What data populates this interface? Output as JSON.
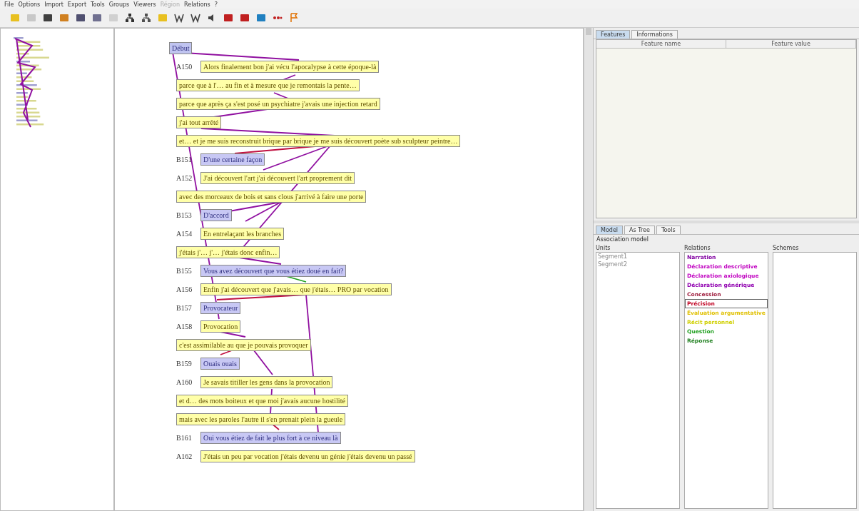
{
  "menu": [
    {
      "label": "File",
      "disabled": false
    },
    {
      "label": "Options",
      "disabled": false
    },
    {
      "label": "Import",
      "disabled": false
    },
    {
      "label": "Export",
      "disabled": false
    },
    {
      "label": "Tools",
      "disabled": false
    },
    {
      "label": "Groups",
      "disabled": false
    },
    {
      "label": "Viewers",
      "disabled": false
    },
    {
      "label": "Région",
      "disabled": true
    },
    {
      "label": "Relations",
      "disabled": false
    },
    {
      "label": "?",
      "disabled": false
    }
  ],
  "segments": [
    {
      "kind": "start",
      "text": "Début"
    },
    {
      "kind": "a",
      "speaker": "A150",
      "text": "Alors finalement bon j'ai vécu l'apocalypse à cette époque-là"
    },
    {
      "kind": "a",
      "text": "parce que à l'… au fin et à mesure que je remontais la pente…"
    },
    {
      "kind": "a",
      "text": "parce que après ça s'est posé un psychiatre j'avais une injection retard"
    },
    {
      "kind": "a",
      "text": "j'ai tout arrêté"
    },
    {
      "kind": "a",
      "text": "et… et je me suis reconstruit brique par brique je me suis découvert poète sub sculpteur peintre…"
    },
    {
      "kind": "b",
      "speaker": "B151",
      "text": "D'une certaine façon"
    },
    {
      "kind": "a",
      "speaker": "A152",
      "text": "J'ai découvert l'art j'ai découvert l'art proprement dit"
    },
    {
      "kind": "a",
      "text": "avec des morceaux de bois et sans clous j'arrivé à faire une porte"
    },
    {
      "kind": "b",
      "speaker": "B153",
      "text": "D'accord"
    },
    {
      "kind": "a",
      "speaker": "A154",
      "text": "En entrelaçant les branches"
    },
    {
      "kind": "a",
      "text": "j'étais j'… j'… j'étais donc enfin…"
    },
    {
      "kind": "b",
      "speaker": "B155",
      "text": "Vous avez découvert que vous étiez doué en fait?"
    },
    {
      "kind": "a",
      "speaker": "A156",
      "text": "Enfin j'ai découvert que j'avais… que j'étais… PRO par vocation"
    },
    {
      "kind": "b",
      "speaker": "B157",
      "text": "Provocateur"
    },
    {
      "kind": "a",
      "speaker": "A158",
      "text": "Provocation"
    },
    {
      "kind": "a",
      "text": "c'est assimilable au que je pouvais provoquer"
    },
    {
      "kind": "b",
      "speaker": "B159",
      "text": "Ouais ouais"
    },
    {
      "kind": "a",
      "speaker": "A160",
      "text": "Je savais titiller les gens dans la provocation"
    },
    {
      "kind": "a",
      "text": "et d… des mots boiteux et que moi j'avais aucune hostilité"
    },
    {
      "kind": "a",
      "text": "mais avec les paroles l'autre il s'en prenait plein la gueule"
    },
    {
      "kind": "b",
      "speaker": "B161",
      "text": "Oui vous étiez de fait le plus fort à ce niveau là"
    },
    {
      "kind": "a",
      "speaker": "A162",
      "text": "J'étais un peu par vocation j'étais devenu un génie j'étais devenu un passé"
    }
  ],
  "features_panel": {
    "tabs": [
      {
        "label": "Features",
        "selected": true
      },
      {
        "label": "Informations",
        "selected": false
      }
    ],
    "columns": [
      "Feature name",
      "Feature value"
    ]
  },
  "relations_panel": {
    "tabs": [
      {
        "label": "Model",
        "selected": true
      },
      {
        "label": "As Tree",
        "selected": false
      },
      {
        "label": "Tools",
        "selected": false
      }
    ],
    "title": "Association model",
    "units": {
      "heading": "Units",
      "items": [
        "Segment1",
        "Segment2"
      ]
    },
    "relations": {
      "heading": "Relations",
      "items": [
        {
          "label": "Narration",
          "color": "#8000a0",
          "selected": false
        },
        {
          "label": "Déclaration descriptive",
          "color": "#c000c0",
          "selected": false
        },
        {
          "label": "Déclaration axiologique",
          "color": "#c000c0",
          "selected": false
        },
        {
          "label": "Déclaration générique",
          "color": "#9000b0",
          "selected": false
        },
        {
          "label": "Concession",
          "color": "#a02040",
          "selected": false
        },
        {
          "label": "Précision",
          "color": "#c00020",
          "selected": true
        },
        {
          "label": "Évaluation argumentative",
          "color": "#e0c000",
          "selected": false
        },
        {
          "label": "Récit personnel",
          "color": "#d0d000",
          "selected": false
        },
        {
          "label": "Question",
          "color": "#20a020",
          "selected": false
        },
        {
          "label": "Réponse",
          "color": "#208020",
          "selected": false
        }
      ]
    },
    "schemes": {
      "heading": "Schemes"
    }
  }
}
